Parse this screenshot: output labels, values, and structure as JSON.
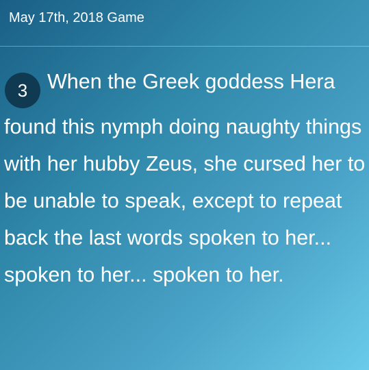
{
  "header": {
    "title": "May 17th, 2018 Game"
  },
  "clue": {
    "number": "3",
    "text": "When the Greek goddess Hera found this nymph doing naughty things with her hubby Zeus, she cursed her to be unable to speak, except to repeat back the last words spoken to her... spoken to her... spoken to her."
  },
  "colors": {
    "badge_bg": "#0f3a52",
    "gradient_start": "#1a5f86",
    "gradient_end": "#6acbea"
  }
}
